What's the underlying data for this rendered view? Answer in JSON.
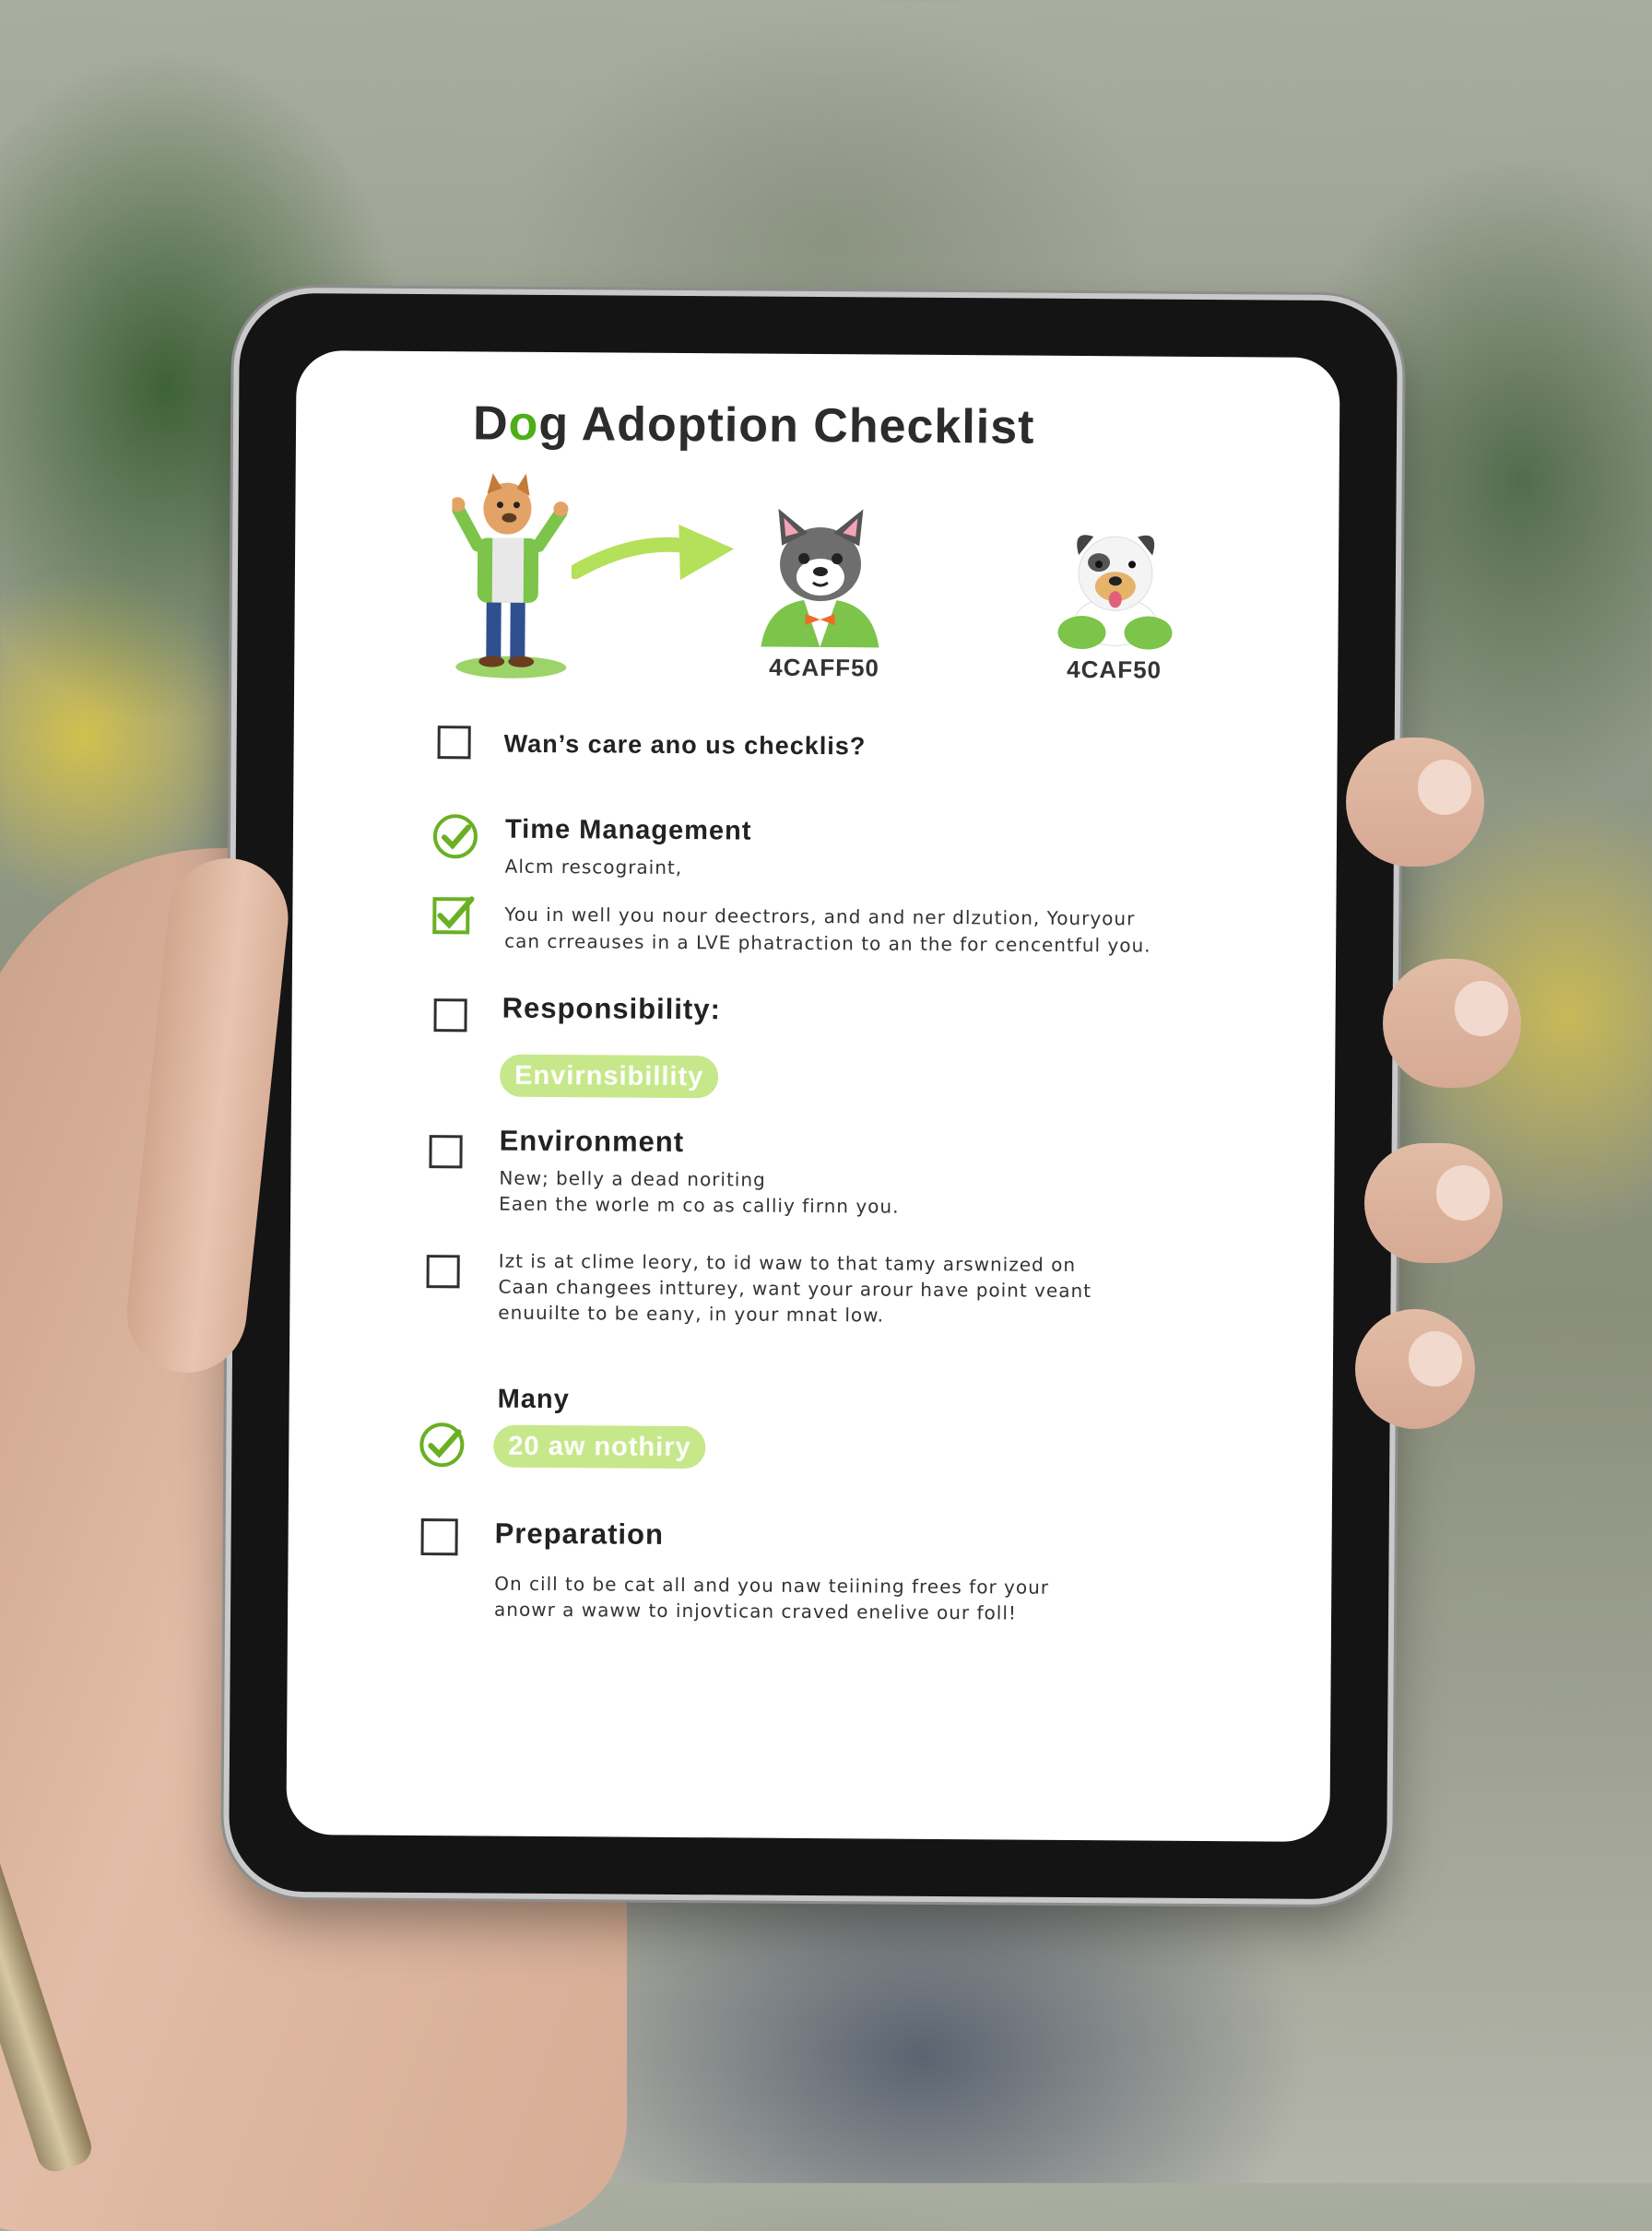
{
  "title": {
    "prefix": "D",
    "highlight": "o",
    "rest": "g Adoption Checklist"
  },
  "illustrations": [
    {
      "icon": "person-with-dog-head-icon",
      "label": ""
    },
    {
      "icon": "arrow-right-icon",
      "label": ""
    },
    {
      "icon": "gray-dog-icon",
      "label": "4CAFF50"
    },
    {
      "icon": "white-dog-icon",
      "label": "4CAF50"
    }
  ],
  "checklist": {
    "intro": {
      "label": "Wan’s care ano us checklis?",
      "checked": false
    },
    "time_management": {
      "title": "Time Management",
      "subtitle": "Alcm rescograint,",
      "checked": true,
      "note_checked": true,
      "note_line1": "You in well you nour deectrors, and and ner dlzution, Youryour",
      "note_line2": "can crreauses in a LVE phatraction to an the for cencentful you."
    },
    "responsibility": {
      "title": "Responsibility:",
      "pill": "Envirnsibillity",
      "checked": false
    },
    "environment": {
      "title": "Environment",
      "line1": "New; belly a dead noriting",
      "line2": "Eaen the worle m co as calliy firnn you.",
      "checked": false
    },
    "extra": {
      "line1": "Izt is at clime leory, to id waw to that tamy arswnized on",
      "line2": "Caan changees intturey, want your arour have point veant",
      "line3": "enuuilte to be eany, in your mnat low.",
      "checked": false
    },
    "many": {
      "title": "Many",
      "pill": "20 aw nothiry",
      "checked": true
    },
    "preparation": {
      "title": "Preparation",
      "line1": "On cill to be cat all and you naw teiining frees for your",
      "line2": "anowr a waww to injovtican craved enelive our foll!",
      "checked": false
    }
  },
  "colors": {
    "accent": "#4caf50",
    "pill": "#c6e88a",
    "check": "#6ab023"
  }
}
